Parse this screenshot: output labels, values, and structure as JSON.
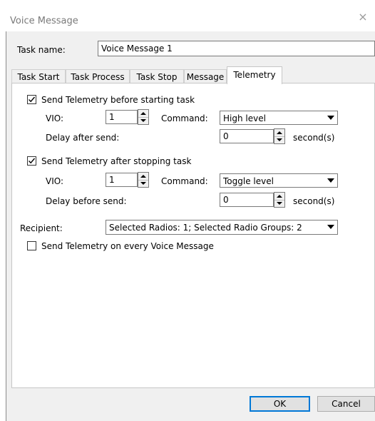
{
  "window": {
    "title": "Voice Message",
    "close_glyph": "×"
  },
  "task_name": {
    "label": "Task name:",
    "value": "Voice Message 1"
  },
  "tabs": [
    {
      "label": "Task Start"
    },
    {
      "label": "Task Process"
    },
    {
      "label": "Task Stop"
    },
    {
      "label": "Message"
    },
    {
      "label": "Telemetry",
      "active": true
    }
  ],
  "before_start": {
    "checkbox_label": "Send Telemetry before starting task",
    "checked": true,
    "vio_label": "VIO:",
    "vio_value": "1",
    "command_label": "Command:",
    "command_value": "High level",
    "delay_label": "Delay after send:",
    "delay_value": "0",
    "delay_unit": "second(s)"
  },
  "after_stop": {
    "checkbox_label": "Send Telemetry after stopping task",
    "checked": true,
    "vio_label": "VIO:",
    "vio_value": "1",
    "command_label": "Command:",
    "command_value": "Toggle level",
    "delay_label": "Delay before send:",
    "delay_value": "0",
    "delay_unit": "second(s)"
  },
  "recipient": {
    "label": "Recipient:",
    "value": "Selected Radios: 1; Selected Radio Groups: 2"
  },
  "every_message": {
    "checkbox_label": "Send Telemetry on every Voice Message",
    "checked": false
  },
  "footer": {
    "ok_label": "OK",
    "cancel_label": "Cancel"
  },
  "colors": {
    "dialog_bg": "#f0f0f0",
    "panel_bg": "#ffffff",
    "focus_blue": "#0078d7"
  }
}
